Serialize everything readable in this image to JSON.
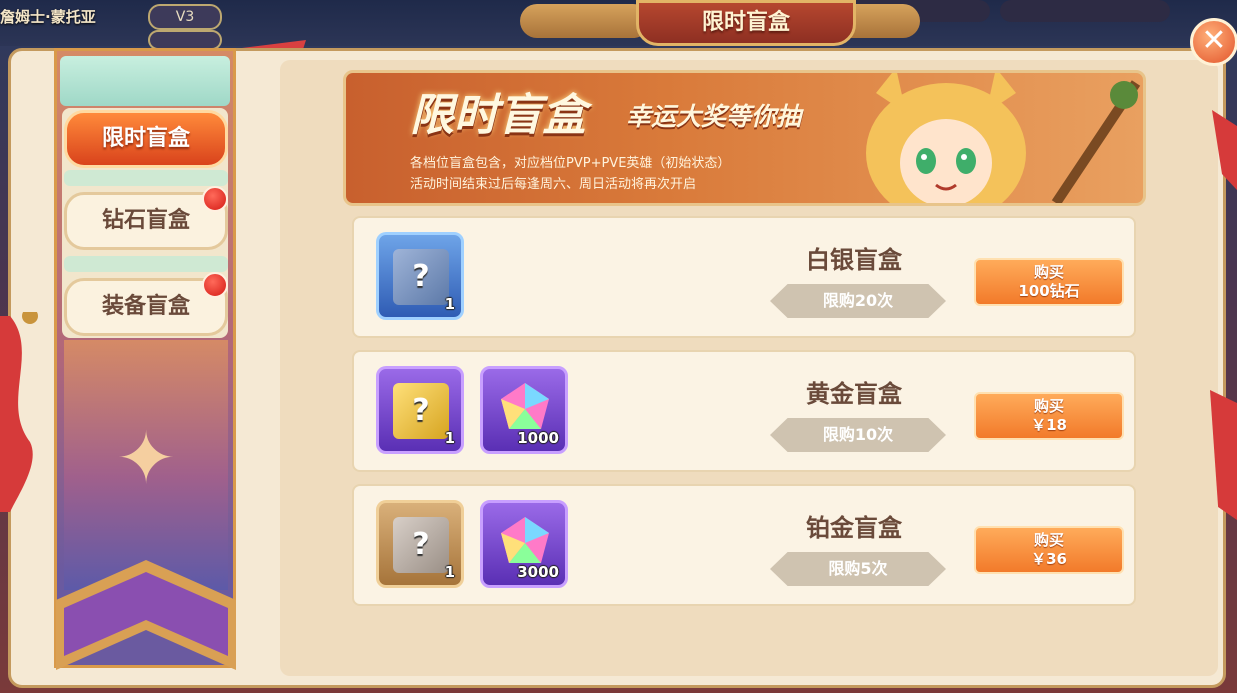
{
  "hud": {
    "player_name": "詹姆士·蒙托亚",
    "vip_level": "V3"
  },
  "window": {
    "title": "限时盲盒",
    "close_icon": "close-icon"
  },
  "sidebar": {
    "tabs": [
      {
        "label": "限时盲盒",
        "active": true,
        "badge": false
      },
      {
        "label": "钻石盲盒",
        "active": false,
        "badge": true
      },
      {
        "label": "装备盲盒",
        "active": false,
        "badge": true
      }
    ]
  },
  "banner": {
    "title": "限时盲盒",
    "subtitle": "幸运大奖等你抽",
    "desc_line1": "各档位盲盒包含，对应档位PVP+PVE英雄（初始状态）",
    "desc_line2": "活动时间结束过后每逢周六、周日活动将再次开启"
  },
  "offers": [
    {
      "name": "白银盲盒",
      "limit": "限购20次",
      "buy_line1": "购买",
      "buy_line2": "100钻石",
      "items": [
        {
          "icon": "silver-mystery-box-icon",
          "count": "1"
        }
      ]
    },
    {
      "name": "黄金盲盒",
      "limit": "限购10次",
      "buy_line1": "购买",
      "buy_line2": "￥18",
      "items": [
        {
          "icon": "gold-mystery-box-icon",
          "count": "1"
        },
        {
          "icon": "diamond-gem-icon",
          "count": "1000"
        }
      ]
    },
    {
      "name": "铂金盲盒",
      "limit": "限购5次",
      "buy_line1": "购买",
      "buy_line2": "￥36",
      "items": [
        {
          "icon": "platinum-mystery-box-icon",
          "count": "1"
        },
        {
          "icon": "diamond-gem-icon",
          "count": "3000"
        }
      ]
    }
  ],
  "colors": {
    "accent_orange": "#f27a2a",
    "active_tab": "#d9431c",
    "badge_red": "#d41a14",
    "panel_bg": "#f5e9d4"
  }
}
